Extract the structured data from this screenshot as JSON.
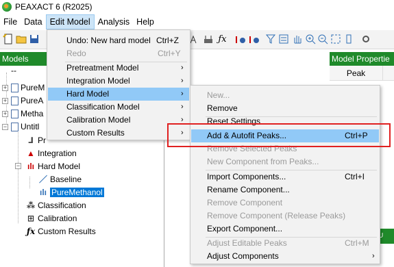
{
  "window": {
    "title": "PEAXACT 6 (R2025)"
  },
  "menubar": {
    "items": [
      "File",
      "Data",
      "Edit Model",
      "Analysis",
      "Help"
    ]
  },
  "panels": {
    "models_title": "Models",
    "properties_title": "Model Propertie",
    "properties_column": "Peak",
    "right_strip_text": "TU"
  },
  "tree": {
    "root": "--",
    "items": [
      "PureM",
      "PureA",
      "Metha",
      "Untitl"
    ],
    "children": {
      "pretreatment": "Pr",
      "integration": "Integration",
      "hard_model": "Hard Model",
      "baseline": "Baseline",
      "pure_methanol": "PureMethanol",
      "classification": "Classification",
      "calibration": "Calibration",
      "custom_results": "Custom Results"
    }
  },
  "edit_menu": {
    "undo": {
      "label": "Undo: New hard model",
      "shortcut": "Ctrl+Z"
    },
    "redo": {
      "label": "Redo",
      "shortcut": "Ctrl+Y"
    },
    "items": [
      "Pretreatment Model",
      "Integration Model",
      "Hard Model",
      "Classification Model",
      "Calibration Model",
      "Custom Results"
    ]
  },
  "hard_model_menu": {
    "new": "New...",
    "remove": "Remove",
    "reset": "Reset Settings",
    "add_autofit": {
      "label": "Add & Autofit Peaks...",
      "shortcut": "Ctrl+P"
    },
    "remove_selected": "Remove Selected Peaks",
    "new_component": "New Component from Peaks...",
    "import_components": {
      "label": "Import Components...",
      "shortcut": "Ctrl+I"
    },
    "rename_component": "Rename Component...",
    "remove_component": "Remove Component",
    "remove_component_release": "Remove Component (Release Peaks)",
    "export_component": "Export Component...",
    "adjust_editable": {
      "label": "Adjust Editable Peaks",
      "shortcut": "Ctrl+M"
    },
    "adjust_components": "Adjust Components"
  },
  "colors": {
    "panel_header": "#1f8a2a",
    "highlight": "#91c9f7",
    "annotation": "#e02020",
    "selection": "#0078d7"
  }
}
